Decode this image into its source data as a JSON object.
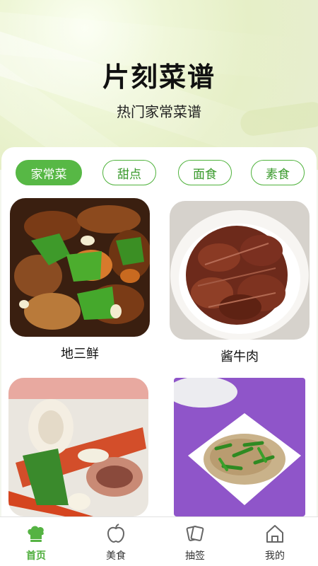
{
  "header": {
    "title": "片刻菜谱",
    "subtitle": "热门家常菜谱"
  },
  "tabs": [
    {
      "label": "家常菜",
      "active": true
    },
    {
      "label": "甜点",
      "active": false
    },
    {
      "label": "面食",
      "active": false
    },
    {
      "label": "素食",
      "active": false
    }
  ],
  "recipes": [
    {
      "name": "地三鲜"
    },
    {
      "name": "酱牛肉"
    },
    {
      "name": ""
    },
    {
      "name": ""
    }
  ],
  "bottom_nav": [
    {
      "label": "首页",
      "icon": "chef-hat-icon",
      "active": true
    },
    {
      "label": "美食",
      "icon": "apple-icon",
      "active": false
    },
    {
      "label": "抽签",
      "icon": "cards-icon",
      "active": false
    },
    {
      "label": "我的",
      "icon": "home-icon",
      "active": false
    }
  ],
  "colors": {
    "accent": "#57b845",
    "active_text": "#4fae3c"
  }
}
